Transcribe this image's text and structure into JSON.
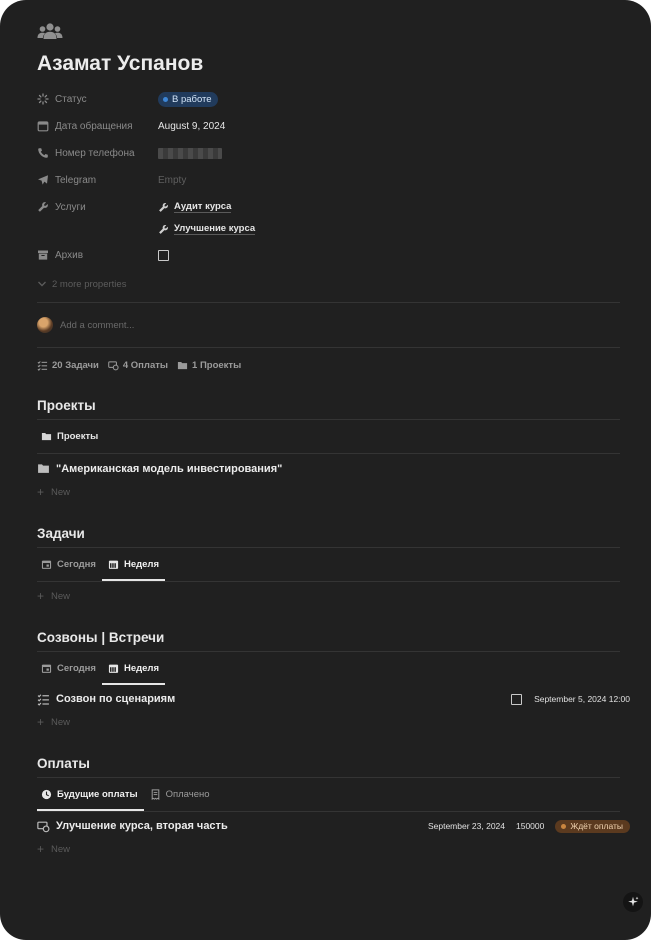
{
  "page": {
    "icon": "people-group-icon",
    "title": "Азамат Успанов"
  },
  "properties": {
    "status": {
      "label": "Статус",
      "value": "В работе",
      "color": "#213b5c",
      "dot_color": "#3d86d6"
    },
    "date": {
      "label": "Дата обращения",
      "value": "August 9, 2024"
    },
    "phone": {
      "label": "Номер телефона",
      "value_hidden": true
    },
    "telegram": {
      "label": "Telegram",
      "value": "Empty"
    },
    "services": {
      "label": "Услуги",
      "items": [
        "Аудит курса",
        "Улучшение курса"
      ]
    },
    "archive": {
      "label": "Архив",
      "checked": false
    },
    "more": "2 more properties"
  },
  "comment": {
    "placeholder": "Add a comment..."
  },
  "relations": [
    {
      "icon": "task-list-icon",
      "label": "20 Задачи"
    },
    {
      "icon": "payment-icon",
      "label": "4 Оплаты"
    },
    {
      "icon": "folder-icon",
      "label": "1 Проекты"
    }
  ],
  "projects": {
    "title": "Проекты",
    "tab": "Проекты",
    "rows": [
      "\"Американская модель инвестирования\""
    ],
    "new_label": "New"
  },
  "tasks": {
    "title": "Задачи",
    "tabs": [
      "Сегодня",
      "Неделя"
    ],
    "active_tab": "Неделя",
    "new_label": "New"
  },
  "calls": {
    "title": "Созвоны | Встречи",
    "tabs": [
      "Сегодня",
      "Неделя"
    ],
    "active_tab": "Неделя",
    "rows": [
      {
        "title": "Созвон по сценариям",
        "checked": false,
        "date": "September 5, 2024 12:00"
      }
    ],
    "new_label": "New"
  },
  "payments": {
    "title": "Оплаты",
    "tabs": [
      "Будущие оплаты",
      "Оплачено"
    ],
    "active_tab": "Будущие оплаты",
    "rows": [
      {
        "title": "Улучшение курса, вторая часть",
        "date": "September 23, 2024",
        "amount": "150000",
        "status": "Ждёт оплаты",
        "status_color": "#5b3a1f"
      }
    ],
    "new_label": "New"
  }
}
